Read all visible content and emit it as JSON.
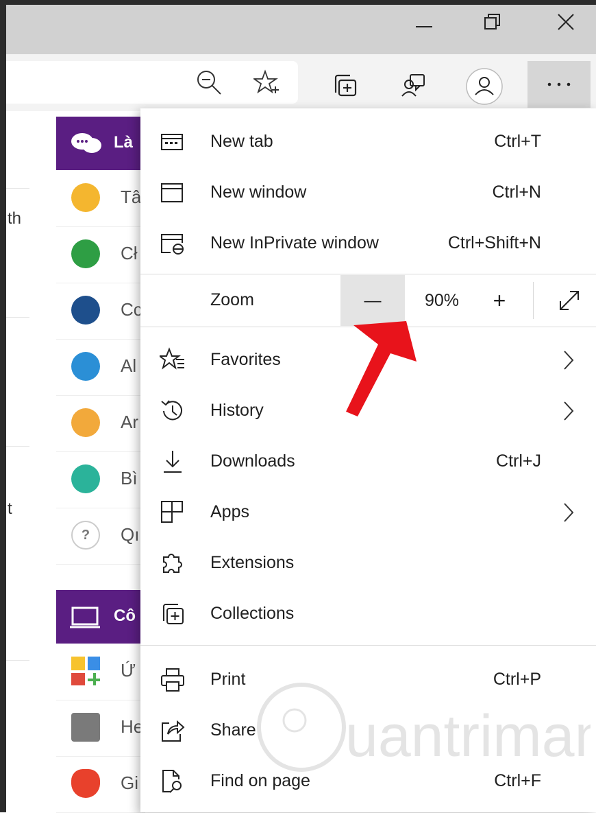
{
  "window": {
    "minimize_icon": "minimize-icon",
    "maximize_icon": "restore-icon",
    "close_icon": "close-icon"
  },
  "toolbar": {
    "icons": [
      "zoom-out-icon",
      "add-favorite-icon",
      "collections-icon",
      "feedback-icon",
      "profile-icon",
      "settings-more-icon"
    ]
  },
  "page": {
    "stray_letters": [
      "th",
      "t"
    ],
    "sections": [
      {
        "header": "Là",
        "rows": [
          "Tâ",
          "Cł",
          "Cc",
          "Al",
          "Ar",
          "Bì",
          "Qı"
        ]
      },
      {
        "header": "Cô",
        "rows": [
          "Ứ",
          "He",
          "Gi"
        ]
      }
    ]
  },
  "menu": {
    "items_group1": [
      {
        "label": "New tab",
        "shortcut": "Ctrl+T",
        "icon": "new-tab-icon"
      },
      {
        "label": "New window",
        "shortcut": "Ctrl+N",
        "icon": "new-window-icon"
      },
      {
        "label": "New InPrivate window",
        "shortcut": "Ctrl+Shift+N",
        "icon": "inprivate-icon"
      }
    ],
    "zoom": {
      "label": "Zoom",
      "minus": "—",
      "value": "90%",
      "plus": "+",
      "fullscreen_icon": "fullscreen-icon"
    },
    "items_group2": [
      {
        "label": "Favorites",
        "shortcut": "",
        "icon": "favorites-icon",
        "submenu": true
      },
      {
        "label": "History",
        "shortcut": "",
        "icon": "history-icon",
        "submenu": true
      },
      {
        "label": "Downloads",
        "shortcut": "Ctrl+J",
        "icon": "downloads-icon",
        "submenu": false
      },
      {
        "label": "Apps",
        "shortcut": "",
        "icon": "apps-icon",
        "submenu": true
      },
      {
        "label": "Extensions",
        "shortcut": "",
        "icon": "extensions-icon",
        "submenu": false
      },
      {
        "label": "Collections",
        "shortcut": "",
        "icon": "collections-icon",
        "submenu": false
      }
    ],
    "items_group3": [
      {
        "label": "Print",
        "shortcut": "Ctrl+P",
        "icon": "print-icon"
      },
      {
        "label": "Share",
        "shortcut": "",
        "icon": "share-icon"
      },
      {
        "label": "Find on page",
        "shortcut": "Ctrl+F",
        "icon": "find-on-page-icon"
      }
    ]
  },
  "annotation": {
    "arrow_color": "#e8131b"
  },
  "watermark": {
    "text": "uantrimang"
  },
  "colors": {
    "purple": "#5a1e82",
    "titlebar": "#d1d1d1",
    "toolbar": "#f3f3f3"
  }
}
